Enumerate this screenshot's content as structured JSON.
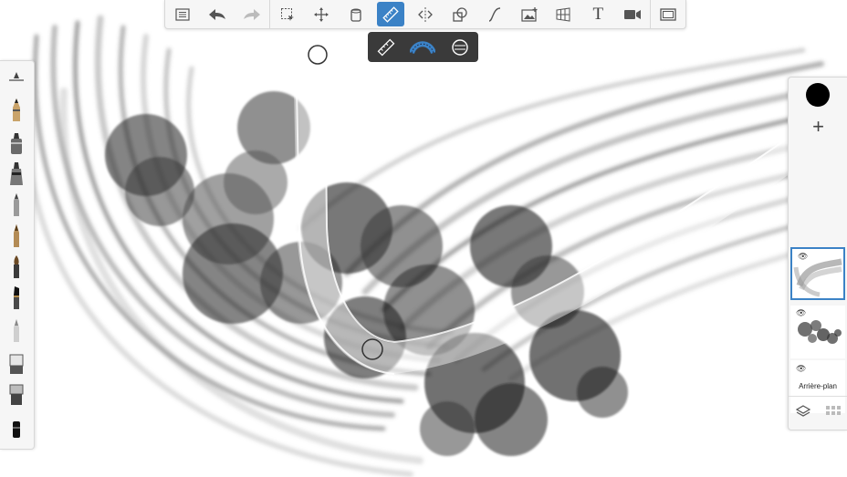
{
  "app": {
    "accent_color": "#3b82c6"
  },
  "toolbar": {
    "items": [
      {
        "name": "list-menu-icon"
      },
      {
        "name": "undo-icon"
      },
      {
        "name": "redo-icon"
      },
      {
        "name": "selection-icon"
      },
      {
        "name": "transform-icon"
      },
      {
        "name": "fill-bucket-icon"
      },
      {
        "name": "ruler-icon",
        "active": true
      },
      {
        "name": "symmetry-icon"
      },
      {
        "name": "shapes-icon"
      },
      {
        "name": "curve-icon"
      },
      {
        "name": "import-image-icon"
      },
      {
        "name": "perspective-grid-icon"
      },
      {
        "name": "text-icon",
        "glyph": "T"
      },
      {
        "name": "video-record-icon"
      },
      {
        "name": "fullscreen-icon"
      }
    ]
  },
  "ruler_options": [
    "straight-ruler-icon",
    "french-curve-icon",
    "ellipse-guide-icon"
  ],
  "brushes": [
    "brush-size-slider-icon",
    "pencil-icon",
    "marker-icon",
    "airbrush-icon",
    "soft-brush-icon",
    "ink-pen-icon",
    "paint-brush-icon",
    "chisel-brush-icon",
    "smudge-icon",
    "eraser-icon",
    "flat-brush-icon",
    "chalk-icon"
  ],
  "layers": {
    "current_color": "#000000",
    "add_label": "+",
    "items": [
      {
        "name": "layer-strokes",
        "selected": true
      },
      {
        "name": "layer-splatter",
        "selected": false
      },
      {
        "name": "layer-background",
        "label": "Arrière-plan"
      }
    ]
  }
}
